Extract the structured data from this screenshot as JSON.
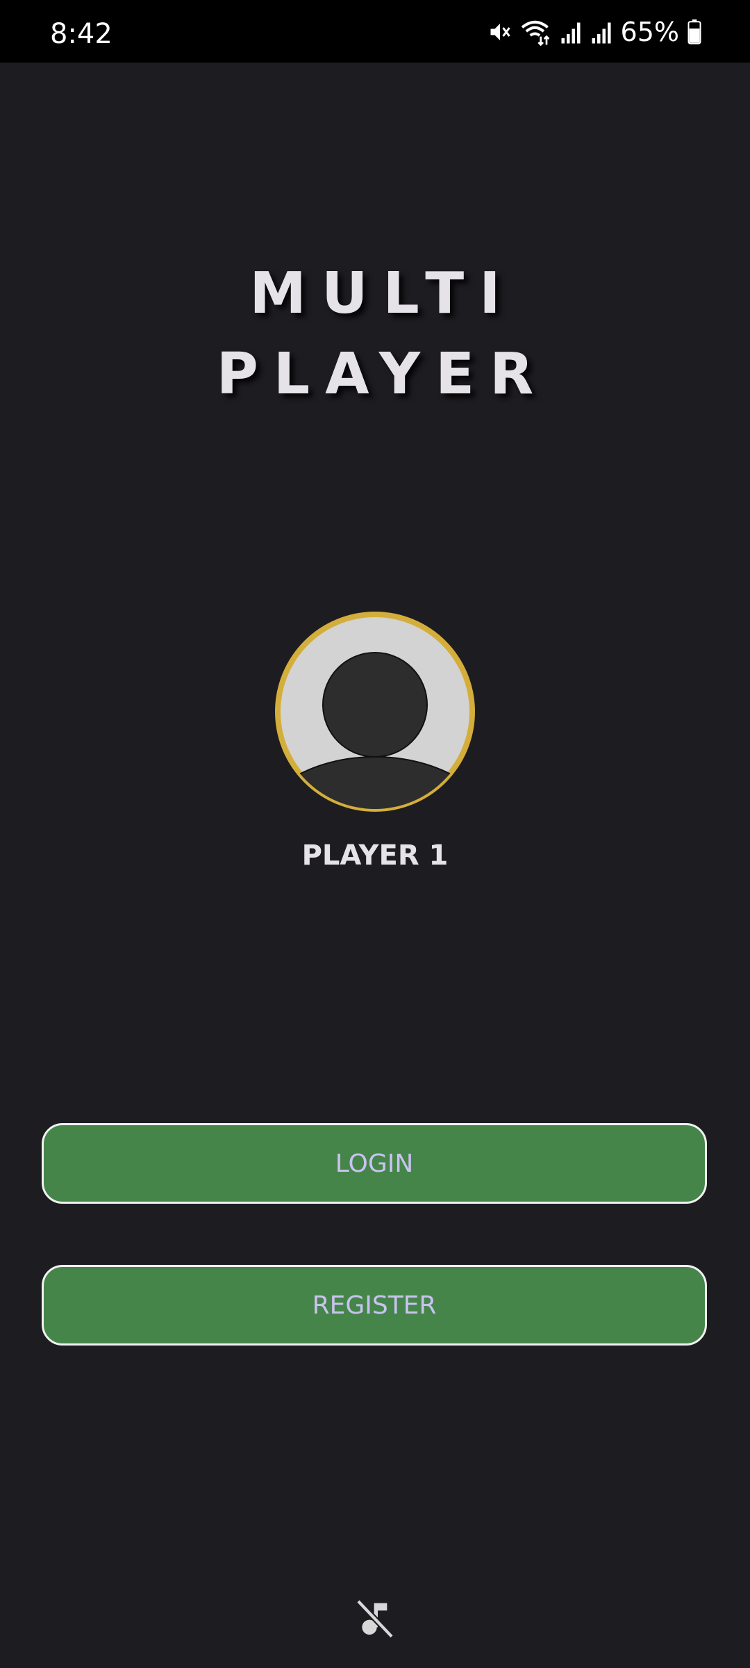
{
  "status_bar": {
    "time": "8:42",
    "battery_percent": "65%",
    "icons": [
      "mute-icon",
      "wifi-icon",
      "signal-icon",
      "signal-icon",
      "battery-icon"
    ]
  },
  "title": {
    "line1": "MULTI",
    "line2": "PLAYER"
  },
  "player": {
    "name": "PLAYER 1",
    "avatar_icon": "user-avatar-icon",
    "avatar_ring_color": "#d4ae3a"
  },
  "buttons": {
    "login_label": "LOGIN",
    "register_label": "REGISTER",
    "button_color": "#45854a"
  },
  "footer": {
    "music_icon": "music-off-icon"
  },
  "colors": {
    "background": "#1d1c21",
    "text": "#e5e3e8",
    "button_text": "#c9c3f0"
  }
}
